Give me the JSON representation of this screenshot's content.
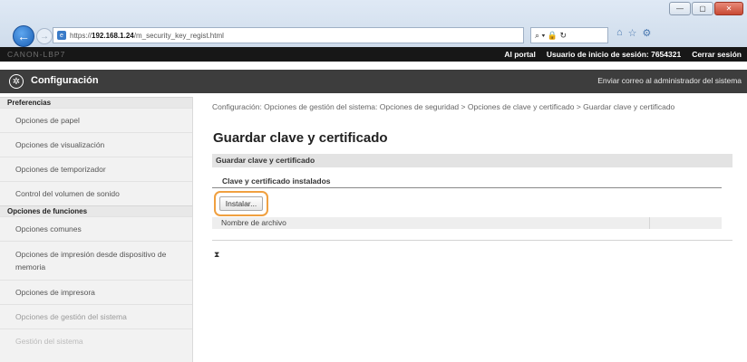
{
  "browser": {
    "url_prefix": "https://",
    "url_host": "192.168.1.24",
    "url_path": "/m_security_key_regist.html",
    "search_glyphs": "⌕ ▾ 🔒 ↻",
    "toolbar_icons": [
      "⌂",
      "☆",
      "⚙"
    ],
    "window_controls": [
      "—",
      "▢",
      "✕"
    ]
  },
  "topbar": {
    "site_name": "CANON-LBP7",
    "portal": "Al portal",
    "login_user_label": "Usuario de inicio de sesión:",
    "login_user_value": "7654321",
    "logout": "Cerrar sesión"
  },
  "header": {
    "title": "Configuración",
    "mail_admin": "Enviar correo al administrador del sistema"
  },
  "sidebar": {
    "categories": [
      {
        "label": "Preferencias"
      },
      {
        "label": "Opciones de funciones"
      }
    ],
    "items": [
      {
        "label": "Opciones de papel"
      },
      {
        "label": "Opciones de visualización"
      },
      {
        "label": "Opciones de temporizador"
      },
      {
        "label": "Control del volumen de sonido"
      },
      {
        "label": "Opciones comunes"
      },
      {
        "label": "Opciones de impresión desde dispositivo de memoria"
      },
      {
        "label": "Opciones de impresora"
      },
      {
        "label": "Opciones de gestión del sistema"
      },
      {
        "label": "Gestión del sistema"
      }
    ]
  },
  "main": {
    "breadcrumb": "Configuración: Opciones de gestión del sistema: Opciones de seguridad > Opciones de clave y certificado > Guardar clave y certificado",
    "page_title": "Guardar clave y certificado",
    "section_title": "Guardar clave y certificado",
    "subsection_title": "Clave y certificado instalados",
    "install_button": "Instalar...",
    "file_column": "Nombre de archivo",
    "collapse_glyph": "⧗"
  }
}
